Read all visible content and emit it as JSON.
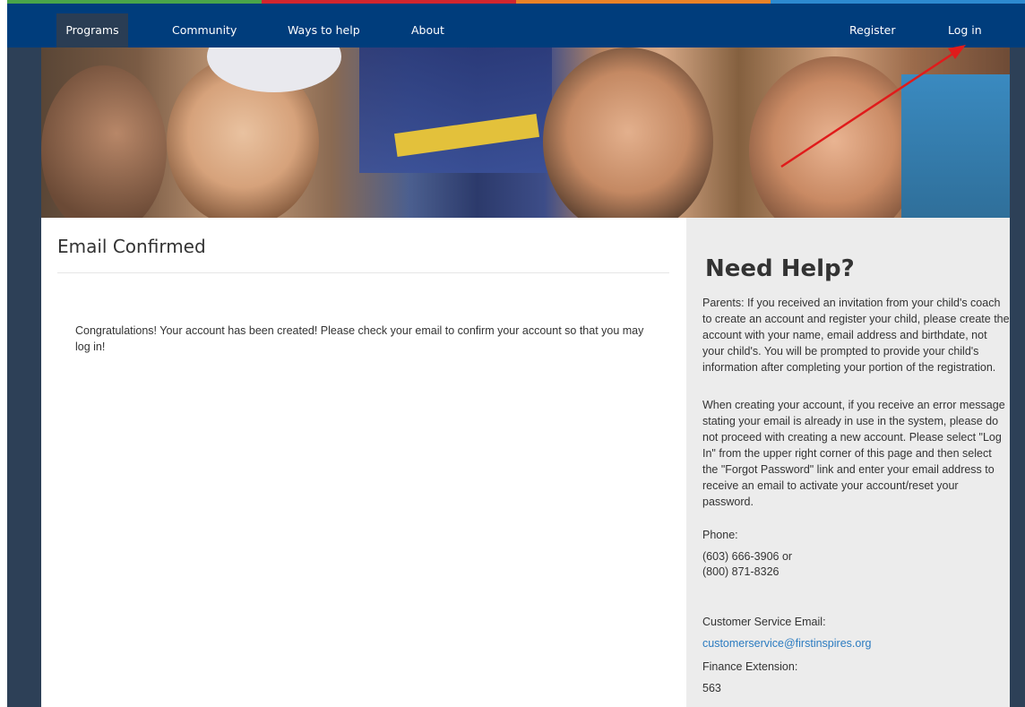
{
  "nav": {
    "items": [
      "Programs",
      "Community",
      "Ways to help",
      "About"
    ],
    "register": "Register",
    "login": "Log in"
  },
  "colors": {
    "strip": [
      "#4aa54a",
      "#d2262e",
      "#e98227",
      "#2d8ad0"
    ],
    "nav_bg": "#003d7c",
    "accent_link": "#2b7bc0"
  },
  "main": {
    "title": "Email Confirmed",
    "message": "Congratulations! Your account has been created! Please check your email to confirm your account so that you may log in!"
  },
  "help": {
    "title": "Need Help?",
    "para1": "Parents: If you received an invitation from your child's coach to create an account and register your child, please create the account with your name, email address and birthdate, not your child's. You will be prompted to provide your child's information after completing your portion of the registration.",
    "para2": "When creating your account, if you receive an error message stating your email is already in use in the system, please do not proceed with creating a new account. Please select \"Log In\" from the upper right corner of this page and then select the \"Forgot Password\" link and enter your email address to receive an email to activate your account/reset your password.",
    "phone_label": "Phone:",
    "phone1": "(603) 666-3906 or",
    "phone2": "(800) 871-8326",
    "email_label": "Customer Service Email:",
    "email": "customerservice@firstinspires.org",
    "finance_label": "Finance Extension:",
    "finance": "563"
  }
}
